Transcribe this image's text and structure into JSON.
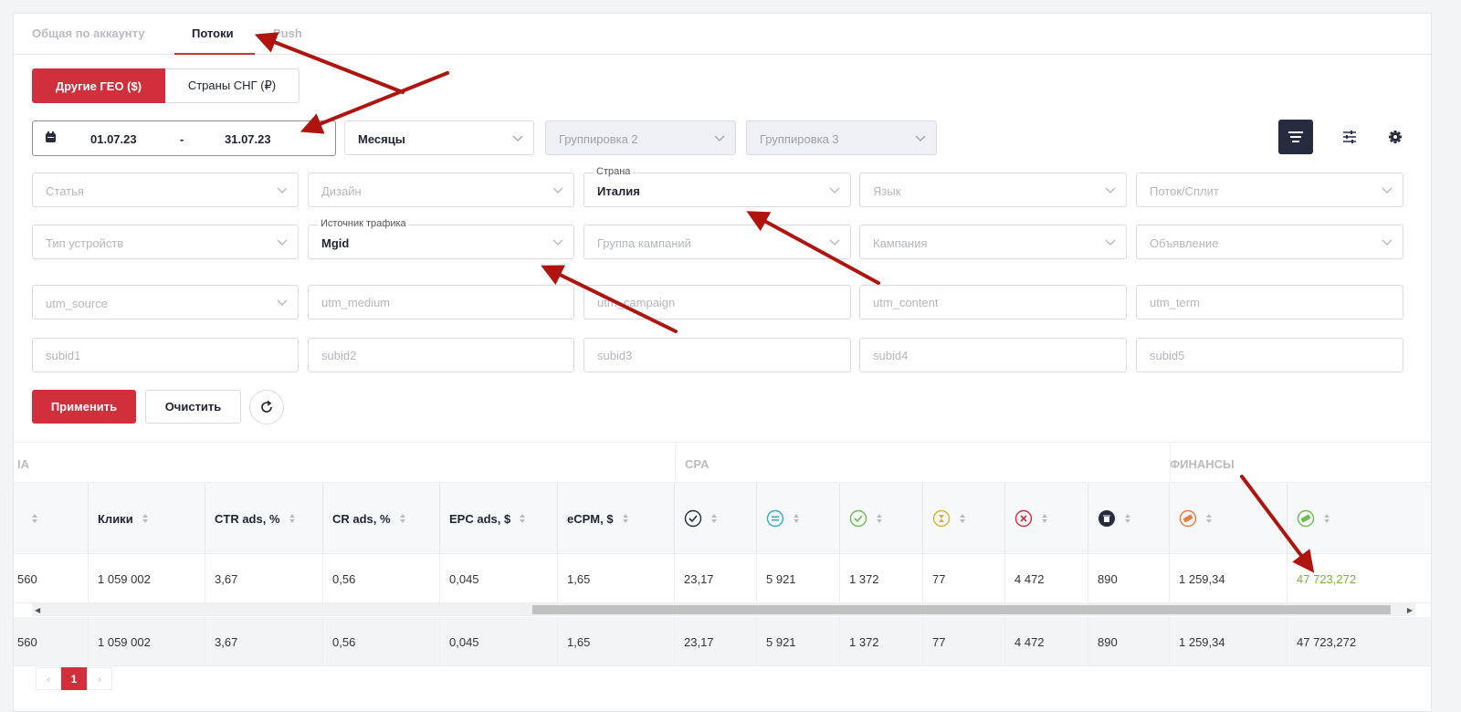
{
  "tabs": [
    {
      "label": "Общая по аккаунту"
    },
    {
      "label": "Потоки"
    },
    {
      "label": "Push"
    }
  ],
  "geo_toggle": {
    "active": "Другие ГЕО ($)",
    "inactive": "Страны СНГ (₽)"
  },
  "date_range": {
    "from": "01.07.23",
    "separator": "-",
    "to": "31.07.23"
  },
  "grouping": {
    "group1": "Месяцы",
    "group2": "Группировка 2",
    "group3": "Группировка 3"
  },
  "filters": {
    "article": "Статья",
    "design": "Дизайн",
    "country_label": "Страна",
    "country_value": "Италия",
    "language": "Язык",
    "stream_split": "Поток/Сплит",
    "device_type": "Тип устройств",
    "traffic_source_label": "Источник трафика",
    "traffic_source_value": "Mgid",
    "campaign_group": "Группа кампаний",
    "campaign": "Кампания",
    "ad": "Объявление"
  },
  "utm": {
    "source": "utm_source",
    "medium": "utm_medium",
    "campaign": "utm_campaign",
    "content": "utm_content",
    "term": "utm_term"
  },
  "subids": [
    "subid1",
    "subid2",
    "subid3",
    "subid4",
    "subid5"
  ],
  "actions": {
    "apply": "Применить",
    "clear": "Очистить"
  },
  "table": {
    "groups": {
      "first_partial": "ІА",
      "cpa": "CPA",
      "finance": "ФИНАНСЫ"
    },
    "headers": {
      "clicks": "Клики",
      "ctr": "CTR ads, %",
      "cr": "CR ads, %",
      "epc": "EPC ads, $",
      "ecpm": "eCPM, $"
    },
    "row": {
      "first_partial": "560",
      "clicks": "1 059 002",
      "ctr": "3,67",
      "cr": "0,56",
      "epc": "0,045",
      "ecpm": "1,65",
      "cpa_total": "23,17",
      "confirmed": "5 921",
      "approved": "1 372",
      "hold": "77",
      "rejected": "4 472",
      "trash": "890",
      "spend": "1 259,34",
      "revenue": "47 723,272"
    },
    "total": {
      "first_partial": "560",
      "clicks": "1 059 002",
      "ctr": "3,67",
      "cr": "0,56",
      "epc": "0,045",
      "ecpm": "1,65",
      "cpa_total": "23,17",
      "confirmed": "5 921",
      "approved": "1 372",
      "hold": "77",
      "rejected": "4 472",
      "trash": "890",
      "spend": "1 259,34",
      "revenue": "47 723,272"
    }
  },
  "pagination": {
    "prev": "‹",
    "current": "1",
    "next": "›"
  },
  "colors": {
    "accent": "#d12f3c",
    "dark_button": "#262b40",
    "revenue_green": "#7cb342",
    "annotation_arrow": "#b0140f"
  }
}
